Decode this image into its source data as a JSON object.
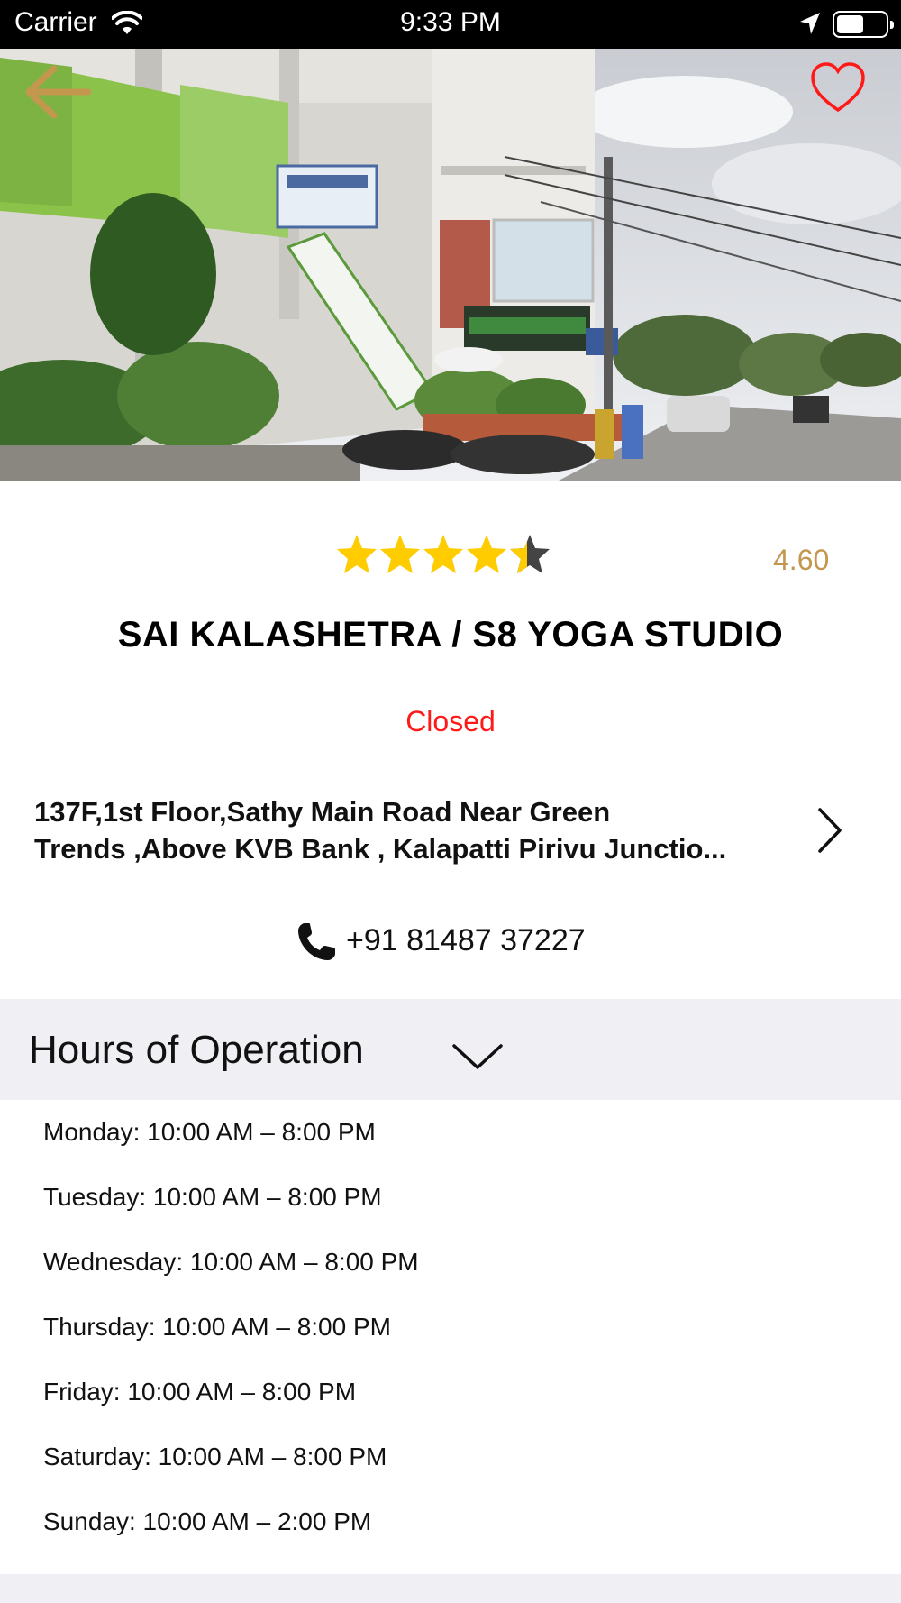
{
  "status_bar": {
    "carrier": "Carrier",
    "time": "9:33 PM",
    "wifi_icon": "wifi-icon",
    "location_icon": "location-arrow-icon",
    "battery_icon": "battery-icon",
    "battery_level": 0.55
  },
  "hero": {
    "back_icon": "arrow-left-icon",
    "favorite_icon": "heart-outline-icon",
    "accent_color": "#c4974f",
    "favorite_color": "#ff1a1a"
  },
  "rating": {
    "value": "4.60",
    "stars_filled": 4.6,
    "stars_max": 5,
    "star_color": "#ffcc00"
  },
  "business": {
    "name": "SAI KALASHETRA / S8 YOGA STUDIO",
    "status": "Closed",
    "status_color": "#ff1a1a",
    "address_line1": "137F,1st Floor,Sathy Main Road Near Green",
    "address_line2": "Trends ,Above KVB Bank , Kalapatti Pirivu Junctio...",
    "phone": "+91 81487 37227",
    "phone_icon": "phone-icon",
    "address_chevron_icon": "chevron-right-icon"
  },
  "hours": {
    "title": "Hours of Operation",
    "expand_icon": "chevron-down-icon",
    "days": [
      "Monday: 10:00 AM – 8:00 PM",
      "Tuesday: 10:00 AM – 8:00 PM",
      "Wednesday: 10:00 AM – 8:00 PM",
      "Thursday: 10:00 AM – 8:00 PM",
      "Friday: 10:00 AM – 8:00 PM",
      "Saturday: 10:00 AM – 8:00 PM",
      "Sunday: 10:00 AM – 2:00 PM"
    ]
  }
}
